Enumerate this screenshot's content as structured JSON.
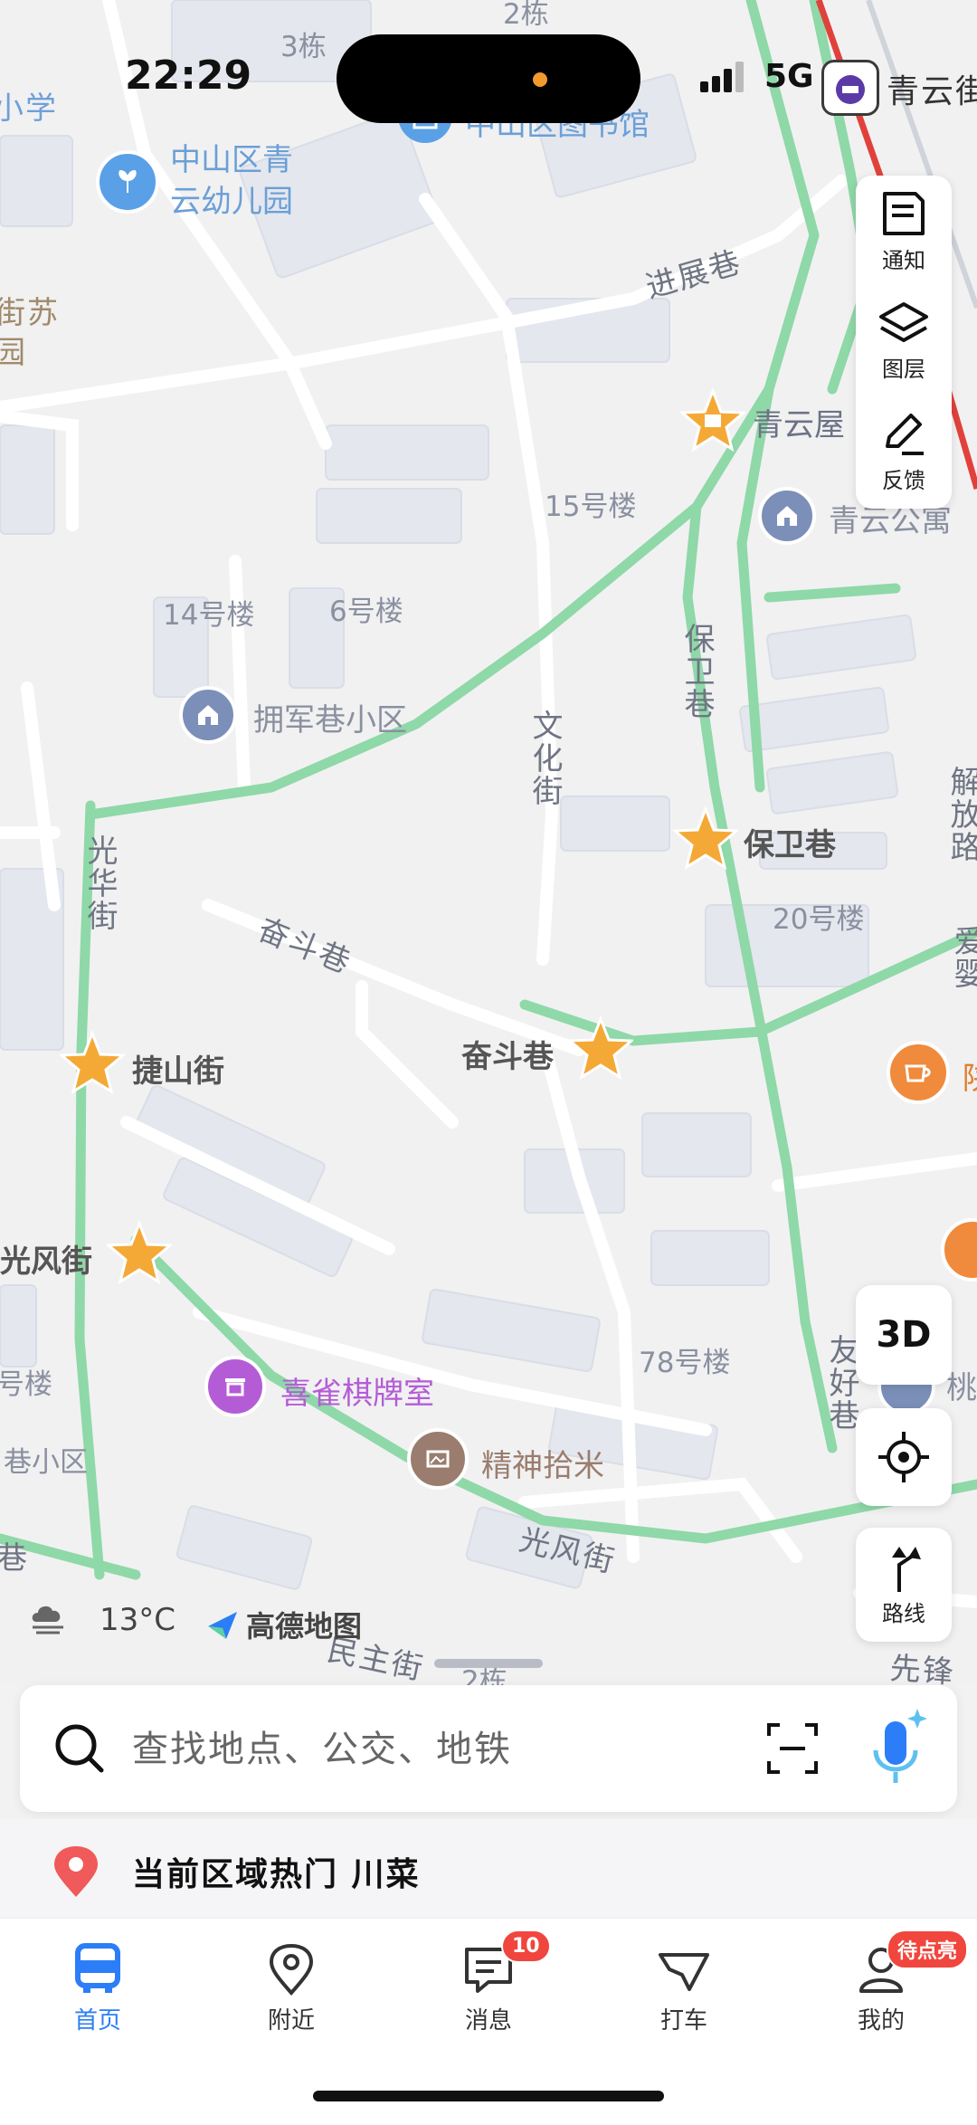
{
  "status_bar": {
    "time": "22:29",
    "network": "5G"
  },
  "map": {
    "edge_labels": [
      "3栋",
      "2栋",
      "小学",
      "青云街",
      "街苏",
      "园",
      "号楼",
      "巷小区",
      "巷",
      "陕",
      "桃",
      "先锋"
    ],
    "road_labels": [
      "进展巷",
      "保卫巷",
      "文化街",
      "光华街",
      "奋斗巷",
      "光风街",
      "友好巷",
      "解放路",
      "爱婴",
      "民主街"
    ],
    "building_labels": [
      "15号楼",
      "14号楼",
      "6号楼",
      "20号楼",
      "78号楼",
      "2栋"
    ],
    "pois": {
      "library": "中山区图书馆",
      "kindergarten": "中山区青\n云幼儿园",
      "qingyun_house": "青云屋",
      "qingyun_apartment": "青云公寓",
      "yongjun_community": "拥军巷小区",
      "baowei_lane_star": "保卫巷",
      "fendou_lane_star": "奋斗巷",
      "jieshan_street_star": "捷山街",
      "guangfeng_street_star": "光风街",
      "chess_room": "喜雀棋牌室",
      "jingshen_shimi": "精神拾米"
    },
    "colors": {
      "road_green": "#8fd8a8",
      "star": "#f4a936",
      "poi_blue": "#7b8fb8",
      "chess_purple": "#b45cd6",
      "railway_red": "#e0423b"
    }
  },
  "tools": {
    "notify": "通知",
    "layers": "图层",
    "feedback": "反馈",
    "three_d": "3D",
    "route": "路线"
  },
  "weather": {
    "temp": "13°C",
    "icon": "cloud-fog-icon"
  },
  "brand": {
    "name": "高德地图"
  },
  "search": {
    "placeholder": "查找地点、公交、地铁"
  },
  "hot": {
    "text": "当前区域热门 川菜"
  },
  "tabs": [
    {
      "label": "首页",
      "icon": "bus-icon",
      "active": true
    },
    {
      "label": "附近",
      "icon": "pin-icon"
    },
    {
      "label": "消息",
      "icon": "message-icon",
      "badge": "10"
    },
    {
      "label": "打车",
      "icon": "taxi-icon"
    },
    {
      "label": "我的",
      "icon": "user-icon",
      "badge": "待点亮"
    }
  ]
}
